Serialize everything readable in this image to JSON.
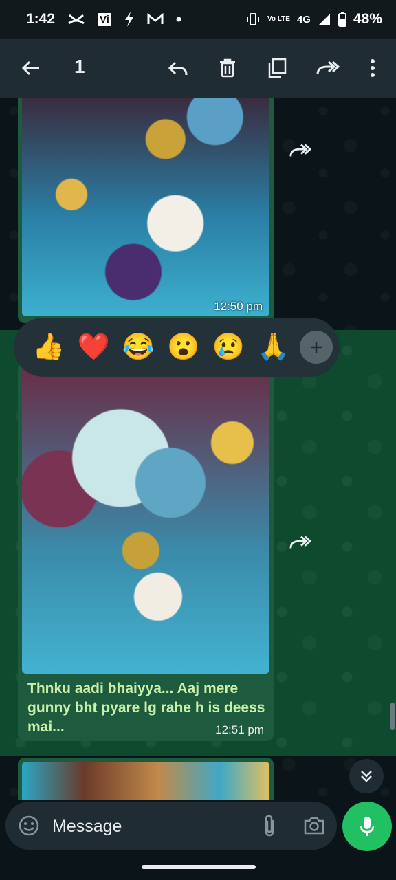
{
  "status_bar": {
    "time": "1:42",
    "carrier_badge": "Vi",
    "network": "4G",
    "volte": "Vo LTE",
    "battery": "48%",
    "icons": [
      "call-missed-icon",
      "vi-icon",
      "bolt-icon",
      "gmail-icon",
      "dot-icon",
      "vibrate-icon",
      "signal-icon",
      "battery-icon"
    ]
  },
  "action_bar": {
    "selected_count": "1",
    "icons": [
      "back-arrow-icon",
      "reply-icon",
      "delete-icon",
      "copy-icon",
      "forward-icon",
      "more-icon"
    ]
  },
  "messages": [
    {
      "time": "12:50 pm",
      "type": "image"
    },
    {
      "time": "12:51 pm",
      "type": "image",
      "caption": "Thnku aadi bhaiyya... Aaj mere gunny bht pyare lg rahe h is deess mai..."
    },
    {
      "type": "image-partial"
    }
  ],
  "reactions": [
    "👍",
    "❤️",
    "😂",
    "😮",
    "😢",
    "🙏"
  ],
  "compose": {
    "placeholder": "Message",
    "icons": [
      "emoji-icon",
      "attach-icon",
      "camera-icon",
      "mic-icon"
    ]
  },
  "colors": {
    "selected_band": "#0d4a2e",
    "bubble": "#1e5a3e",
    "caption_text": "#c8f0a8",
    "mic_button": "#21c063",
    "toolbar": "#1f2c33"
  }
}
